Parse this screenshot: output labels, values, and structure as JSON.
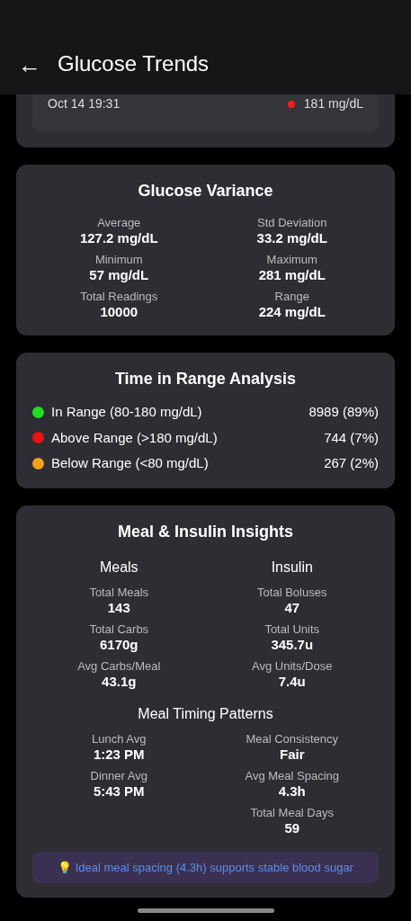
{
  "header": {
    "back_icon": "←",
    "title": "Glucose Trends"
  },
  "recent_readings": [
    {
      "time": "Oct 14 19:31",
      "value": "181 mg/dL",
      "color": "#ff1a1a"
    }
  ],
  "variance": {
    "title": "Glucose Variance",
    "stats": [
      {
        "label": "Average",
        "value": "127.2 mg/dL"
      },
      {
        "label": "Std Deviation",
        "value": "33.2 mg/dL"
      },
      {
        "label": "Minimum",
        "value": "57 mg/dL"
      },
      {
        "label": "Maximum",
        "value": "281 mg/dL"
      },
      {
        "label": "Total Readings",
        "value": "10000"
      },
      {
        "label": "Range",
        "value": "224 mg/dL"
      }
    ]
  },
  "time_in_range": {
    "title": "Time in Range Analysis",
    "rows": [
      {
        "label": "In Range (80-180 mg/dL)",
        "value": "8989 (89%)",
        "color": "#22dd22"
      },
      {
        "label": "Above Range (>180 mg/dL)",
        "value": "744 (7%)",
        "color": "#ee1111"
      },
      {
        "label": "Below Range (<80 mg/dL)",
        "value": "267 (2%)",
        "color": "#f5a020"
      }
    ]
  },
  "insights": {
    "title": "Meal & Insulin Insights",
    "columns": [
      {
        "heading": "Meals",
        "stats": [
          {
            "label": "Total Meals",
            "value": "143"
          },
          {
            "label": "Total Carbs",
            "value": "6170g"
          },
          {
            "label": "Avg Carbs/Meal",
            "value": "43.1g"
          }
        ]
      },
      {
        "heading": "Insulin",
        "stats": [
          {
            "label": "Total Boluses",
            "value": "47"
          },
          {
            "label": "Total Units",
            "value": "345.7u"
          },
          {
            "label": "Avg Units/Dose",
            "value": "7.4u"
          }
        ]
      }
    ],
    "timing_title": "Meal Timing Patterns",
    "timing_columns": [
      [
        {
          "label": "Lunch Avg",
          "value": "1:23 PM"
        },
        {
          "label": "Dinner Avg",
          "value": "5:43 PM"
        }
      ],
      [
        {
          "label": "Meal Consistency",
          "value": "Fair"
        },
        {
          "label": "Avg Meal Spacing",
          "value": "4.3h"
        },
        {
          "label": "Total Meal Days",
          "value": "59"
        }
      ]
    ],
    "tip": "💡 Ideal meal spacing (4.3h) supports stable blood sugar"
  }
}
